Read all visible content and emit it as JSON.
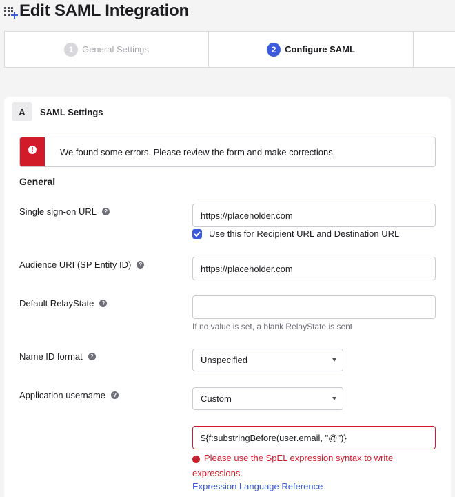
{
  "header": {
    "title": "Edit SAML Integration",
    "icon": "add-app-icon"
  },
  "steps": [
    {
      "number": "1",
      "label": "General Settings",
      "state": "completed"
    },
    {
      "number": "2",
      "label": "Configure SAML",
      "state": "active"
    }
  ],
  "section": {
    "badge": "A",
    "title": "SAML Settings"
  },
  "error_banner": {
    "message": "We found some errors. Please review the form and make corrections."
  },
  "general": {
    "heading": "General",
    "sso_url": {
      "label": "Single sign-on URL",
      "value": "https://placeholder.com",
      "checkbox_label": "Use this for Recipient URL and Destination URL",
      "checkbox_checked": true
    },
    "audience_uri": {
      "label": "Audience URI (SP Entity ID)",
      "value": "https://placeholder.com"
    },
    "relay_state": {
      "label": "Default RelayState",
      "value": "",
      "hint": "If no value is set, a blank RelayState is sent"
    },
    "name_id_format": {
      "label": "Name ID format",
      "selected": "Unspecified"
    },
    "app_username": {
      "label": "Application username",
      "selected": "Custom",
      "expression": "${f:substringBefore(user.email, \"@\")}",
      "error": "Please use the SpEL expression syntax to write expressions.",
      "link": "Expression Language Reference"
    }
  },
  "colors": {
    "accent": "#3b5bdb",
    "error": "#d11a2a",
    "muted": "#a7a7ad"
  }
}
